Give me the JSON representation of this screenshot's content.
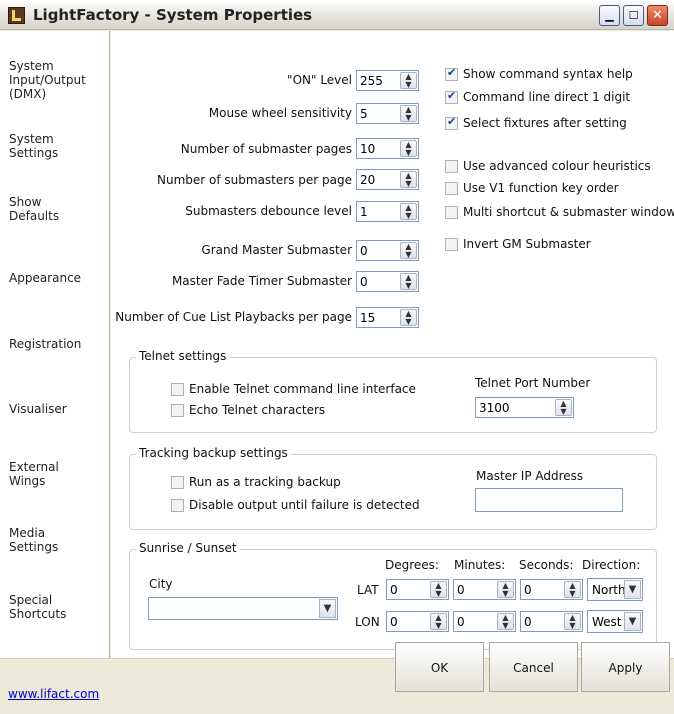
{
  "window": {
    "title": "LightFactory - System Properties",
    "min_glyph": "▁",
    "max_glyph": "☐",
    "close_glyph": "✕"
  },
  "sidebar": {
    "items": [
      {
        "label": "System\nInput/Output\n(DMX)"
      },
      {
        "label": "System\nSettings"
      },
      {
        "label": "Show\nDefaults"
      },
      {
        "label": "Appearance"
      },
      {
        "label": "Registration"
      },
      {
        "label": "Visualiser"
      },
      {
        "label": "External\nWings"
      },
      {
        "label": "Media\nSettings"
      },
      {
        "label": "Special\nShortcuts"
      }
    ]
  },
  "settings": {
    "on_level": {
      "label": "\"ON\" Level",
      "value": "255"
    },
    "mouse_wheel": {
      "label": "Mouse wheel sensitivity",
      "value": "5"
    },
    "submaster_pages": {
      "label": "Number of submaster pages",
      "value": "10"
    },
    "submasters_per_page": {
      "label": "Number of submasters per page",
      "value": "20"
    },
    "debounce": {
      "label": "Submasters debounce level",
      "value": "1"
    },
    "grand_master": {
      "label": "Grand Master Submaster",
      "value": "0"
    },
    "fade_timer": {
      "label": "Master Fade Timer Submaster",
      "value": "0"
    },
    "cue_playbacks": {
      "label": "Number of Cue List Playbacks per page",
      "value": "15"
    }
  },
  "options": [
    {
      "label": "Show command syntax help",
      "checked": true
    },
    {
      "label": "Command line direct 1 digit",
      "checked": true
    },
    {
      "label": "Select fixtures after setting",
      "checked": true
    },
    {
      "label": "Use advanced colour heuristics",
      "checked": false
    },
    {
      "label": "Use V1 function key order",
      "checked": false
    },
    {
      "label": "Multi shortcut & submaster windows",
      "checked": false
    },
    {
      "label": "Invert GM Submaster",
      "checked": false
    }
  ],
  "telnet": {
    "legend": "Telnet settings",
    "enable_label": "Enable Telnet command line interface",
    "echo_label": "Echo Telnet characters",
    "port_label": "Telnet Port Number",
    "port_value": "3100"
  },
  "tracking": {
    "legend": "Tracking backup settings",
    "run_label": "Run as a tracking backup",
    "disable_label": "Disable output until failure is detected",
    "ip_label": "Master IP Address",
    "ip_value": ""
  },
  "sunrise": {
    "legend": "Sunrise / Sunset",
    "city_label": "City",
    "city_value": "",
    "col_degrees": "Degrees:",
    "col_minutes": "Minutes:",
    "col_seconds": "Seconds:",
    "col_direction": "Direction:",
    "lat_label": "LAT",
    "lon_label": "LON",
    "lat": {
      "deg": "0",
      "min": "0",
      "sec": "0",
      "dir": "North"
    },
    "lon": {
      "deg": "0",
      "min": "0",
      "sec": "0",
      "dir": "West"
    }
  },
  "footer": {
    "link": "www.lifact.com",
    "ok": "OK",
    "cancel": "Cancel",
    "apply": "Apply"
  }
}
